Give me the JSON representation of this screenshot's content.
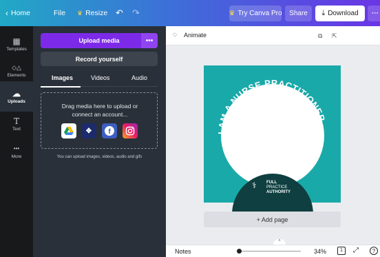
{
  "topbar": {
    "home": "Home",
    "file": "File",
    "resize": "Resize",
    "try_pro": "Try Canva Pro",
    "share": "Share",
    "download": "Download",
    "more": "···"
  },
  "rail": [
    {
      "label": "Templates",
      "icon": "▦"
    },
    {
      "label": "Elements",
      "icon": "◇△"
    },
    {
      "label": "Uploads",
      "icon": "☁"
    },
    {
      "label": "Text",
      "icon": "T"
    },
    {
      "label": "More",
      "icon": "•••"
    }
  ],
  "panel": {
    "upload_media": "Upload media",
    "upload_more": "•••",
    "record": "Record yourself",
    "tabs": [
      "Images",
      "Videos",
      "Audio"
    ],
    "drop_line1": "Drag media here to upload or",
    "drop_line2": "connect an account...",
    "hint": "You can upload images, videos, audio and gifs"
  },
  "workspace": {
    "animate": "Animate",
    "design_text_top": "I AM A NURSE PRACTITIONER",
    "badge_line1": "FULL",
    "badge_line2": "PRACTICE",
    "badge_line3": "AUTHORITY",
    "add_page": "+ Add page"
  },
  "bottombar": {
    "notes": "Notes",
    "zoom": "34%",
    "page_count": "1",
    "zoom_level": 0.34
  },
  "colors": {
    "accent_purple": "#7d2ae8",
    "design_teal": "#1aa9a9",
    "badge_dark": "#0f3f40"
  }
}
